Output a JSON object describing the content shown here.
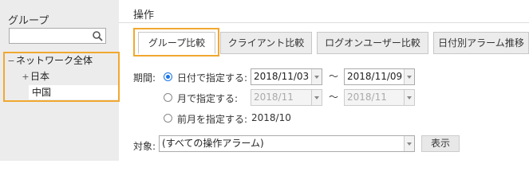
{
  "sidebar": {
    "title": "グループ",
    "search_placeholder": "",
    "search_icon": "search-icon",
    "tree": [
      {
        "toggle": "−",
        "label": "ネットワーク全体"
      },
      {
        "toggle": "+",
        "label": "日本"
      },
      {
        "toggle": "",
        "label": "中国"
      }
    ]
  },
  "main": {
    "title": "操作",
    "tabs": [
      {
        "label": "グループ比較"
      },
      {
        "label": "クライアント比較"
      },
      {
        "label": "ログオンユーザー比較"
      },
      {
        "label": "日付別アラーム推移"
      }
    ],
    "period_label": "期間:",
    "options": {
      "by_date": "日付で指定する:",
      "by_month": "月で指定する:",
      "prev_month": "前月を指定する:"
    },
    "date_from": "2018/11/03",
    "date_to": "2018/11/09",
    "month_from": "2018/11",
    "month_to": "2018/11",
    "tilde": "～",
    "prev_month_value": "2018/10",
    "target_label": "対象:",
    "target_value": "(すべての操作アラーム)",
    "show_button": "表示"
  },
  "colors": {
    "highlight": "#f0a830",
    "radio_active": "#1a73e8"
  }
}
